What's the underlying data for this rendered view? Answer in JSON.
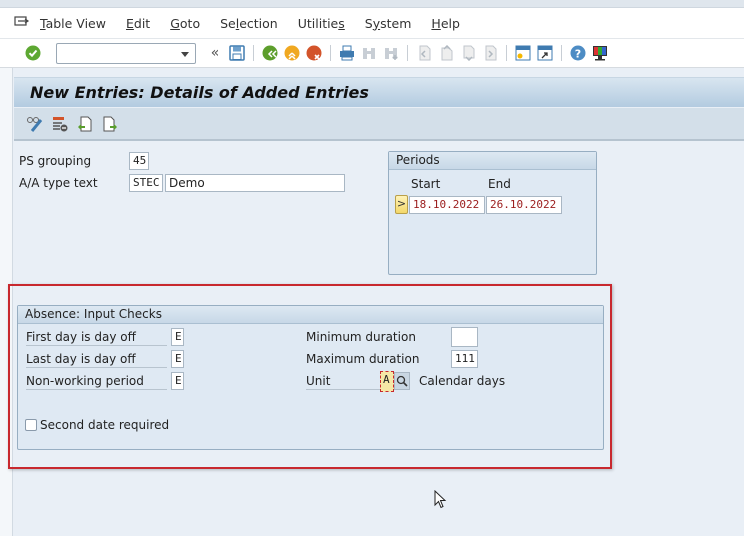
{
  "menubar": {
    "items": [
      {
        "label": "Table View",
        "mnemonic": "T"
      },
      {
        "label": "Edit",
        "mnemonic": "E"
      },
      {
        "label": "Goto",
        "mnemonic": "G"
      },
      {
        "label": "Selection",
        "mnemonic": "l"
      },
      {
        "label": "Utilities",
        "mnemonic": "s"
      },
      {
        "label": "System",
        "mnemonic": "y"
      },
      {
        "label": "Help",
        "mnemonic": "H"
      }
    ]
  },
  "toolbar": {
    "command_field_value": "",
    "icons": [
      "enter-icon",
      "command-dropdown",
      "collapse-icon",
      "save-icon",
      "back-icon",
      "exit-icon",
      "cancel-icon",
      "print-icon",
      "find-icon",
      "find-next-icon",
      "first-page-icon",
      "previous-page-icon",
      "next-page-icon",
      "last-page-icon",
      "new-session-icon",
      "shortcut-icon",
      "help-icon",
      "customize-layout-icon"
    ]
  },
  "title": "New Entries: Details of Added Entries",
  "header_fields": {
    "ps_grouping": {
      "label": "PS grouping",
      "value": "45"
    },
    "aa_type_text": {
      "label": "A/A type text",
      "code": "STEC",
      "value": "Demo"
    }
  },
  "periods": {
    "title": "Periods",
    "start_label": "Start",
    "end_label": "End",
    "selector": ">",
    "start": "18.10.2022",
    "end": "26.10.2022"
  },
  "input_checks": {
    "title": "Absence: Input Checks",
    "left_fields": [
      {
        "label": "First day is day off",
        "value": "E"
      },
      {
        "label": "Last day is day off",
        "value": "E"
      },
      {
        "label": "Non-working period",
        "value": "E"
      }
    ],
    "minimum_duration": {
      "label": "Minimum duration",
      "value": ""
    },
    "maximum_duration": {
      "label": "Maximum duration",
      "value": "111"
    },
    "unit": {
      "label": "Unit",
      "value": "A",
      "description": "Calendar days"
    },
    "second_date_required": {
      "label": "Second date required",
      "checked": false
    }
  },
  "colors": {
    "highlight_frame": "#c8282e",
    "date_text": "#9b1c1c",
    "title_bar": "#b3cbe0"
  }
}
